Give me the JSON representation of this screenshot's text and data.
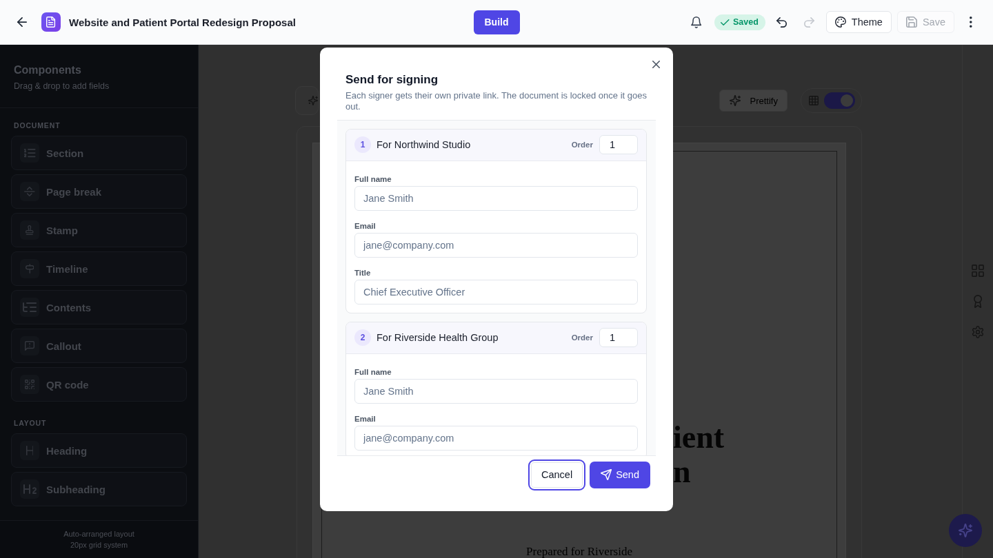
{
  "topbar": {
    "title": "Website and Patient Portal Redesign Proposal",
    "build_button": "Build",
    "save_status": "Saved",
    "undo": {
      "disabled": false
    },
    "redo": {
      "disabled": true
    },
    "theme_button": "Theme",
    "save_button": {
      "label": "Save",
      "disabled": true
    }
  },
  "sidebar": {
    "title": "Components",
    "subtitle": "Drag & drop to add fields",
    "groups": [
      {
        "label": "DOCUMENT",
        "items": [
          "Section",
          "Page break",
          "Stamp",
          "Timeline",
          "Contents",
          "Callout",
          "QR code"
        ]
      },
      {
        "label": "LAYOUT",
        "items": [
          "Heading",
          "Subheading"
        ]
      }
    ],
    "footer": [
      "Auto-arranged layout",
      "20px grid system"
    ]
  },
  "canvas": {
    "prettify_button": "Prettify",
    "grid_toggle": {
      "on": true
    },
    "document": {
      "heading_lines": [
        "ient",
        "n"
      ],
      "subtitle": "Prepared for Riverside"
    }
  },
  "dialog": {
    "title": "Send for signing",
    "description": "Each signer gets their own private link. The document is locked once it goes out.",
    "signers": [
      {
        "number": "1",
        "name": "For Northwind Studio",
        "order_label": "Order",
        "order": "1",
        "fields": [
          {
            "label": "Full name",
            "placeholder": "Jane Smith"
          },
          {
            "label": "Email",
            "placeholder": "jane@company.com"
          },
          {
            "label": "Title",
            "placeholder": "Chief Executive Officer"
          }
        ]
      },
      {
        "number": "2",
        "name": "For Riverside Health Group",
        "order_label": "Order",
        "order": "1",
        "fields": [
          {
            "label": "Full name",
            "placeholder": "Jane Smith"
          },
          {
            "label": "Email",
            "placeholder": "jane@company.com"
          }
        ]
      }
    ],
    "buttons": [
      {
        "label": "Cancel",
        "kind": "secondary",
        "focused": true
      },
      {
        "label": "Send",
        "kind": "primary",
        "focused": false
      }
    ]
  }
}
